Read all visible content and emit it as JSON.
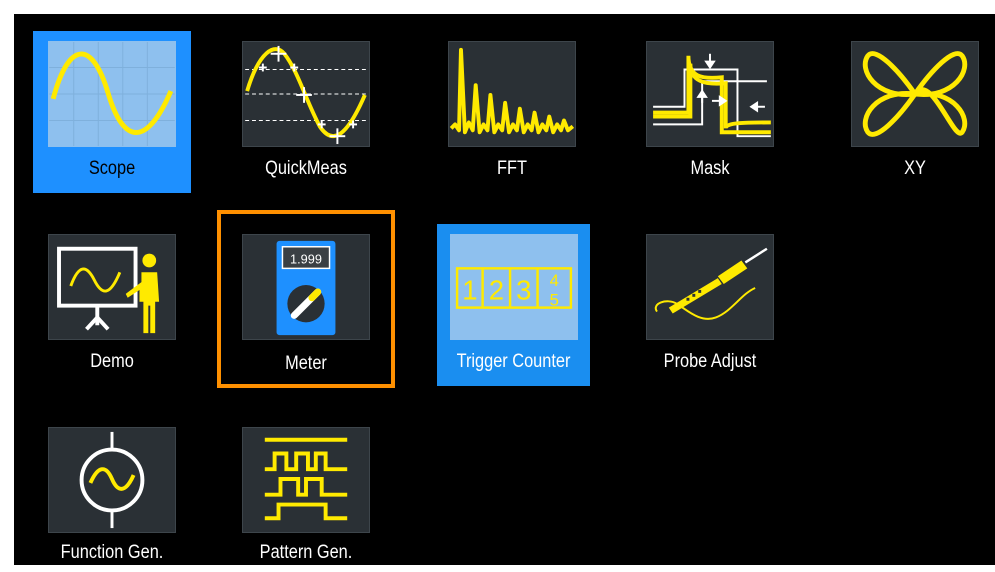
{
  "apps": {
    "scope": "Scope",
    "quickmeas": "QuickMeas",
    "fft": "FFT",
    "mask": "Mask",
    "xy": "XY",
    "demo": "Demo",
    "meter": "Meter",
    "trigger_counter": "Trigger Counter",
    "probe_adjust": "Probe Adjust",
    "function_gen": "Function Gen.",
    "pattern_gen": "Pattern Gen."
  },
  "meter_display": "1.999",
  "counter_digits": [
    "1",
    "2",
    "3",
    "4",
    "5"
  ],
  "icons": {
    "scope": "sine-wave-icon",
    "quickmeas": "measured-sine-icon",
    "fft": "spectrum-icon",
    "mask": "mask-test-icon",
    "xy": "lissajous-icon",
    "demo": "presentation-icon",
    "meter": "multimeter-icon",
    "trigger_counter": "counter-digits-icon",
    "probe_adjust": "probe-icon",
    "function_gen": "signal-source-icon",
    "pattern_gen": "digital-pattern-icon"
  },
  "colors": {
    "background": "#000000",
    "selected": "#1e90ff",
    "focus_border": "#ff9000",
    "waveform": "#ffea00"
  },
  "state": {
    "selected": "Scope",
    "focused": "Meter",
    "active": "Trigger Counter"
  }
}
